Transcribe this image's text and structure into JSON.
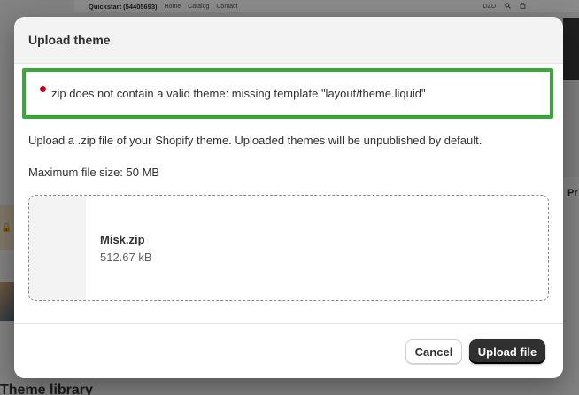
{
  "background": {
    "store_name": "Quickstart (54405693)",
    "nav": [
      "Home",
      "Catalog",
      "Contact"
    ],
    "currency": "DZD",
    "right_preview_label": "Pr",
    "footer_heading": "Theme library"
  },
  "modal": {
    "title": "Upload theme",
    "error_message": "zip does not contain a valid theme: missing template \"layout/theme.liquid\"",
    "description": "Upload a .zip file of your Shopify theme. Uploaded themes will be unpublished by default.",
    "max_size": "Maximum file size: 50 MB",
    "file": {
      "name": "Misk.zip",
      "size": "512.67 kB"
    },
    "buttons": {
      "cancel": "Cancel",
      "upload": "Upload file"
    }
  },
  "colors": {
    "error_dot": "#c4001b",
    "highlight_frame": "#3aa83a",
    "primary_button": "#303030"
  }
}
